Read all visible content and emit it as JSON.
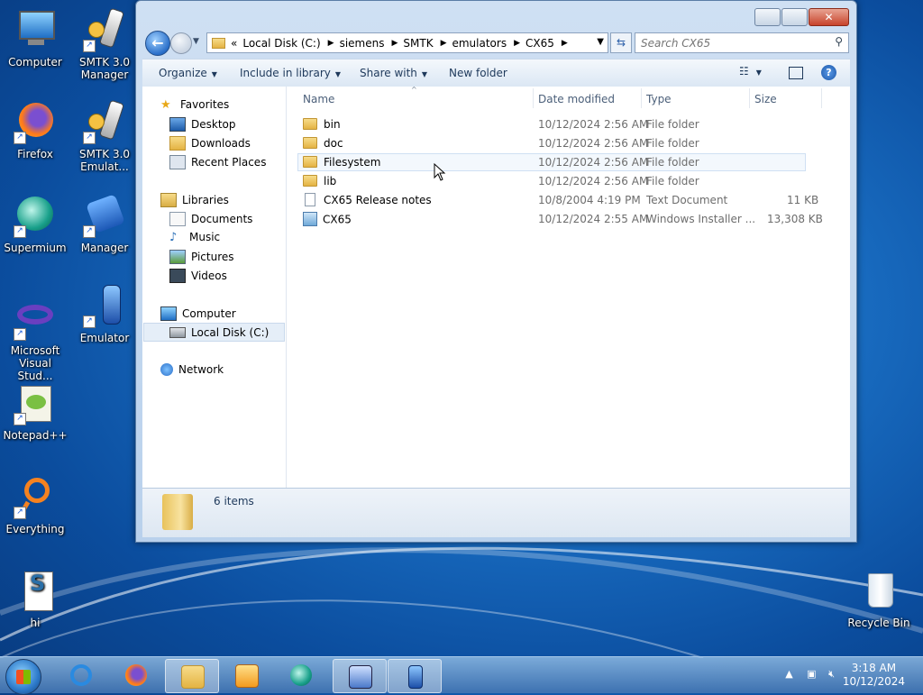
{
  "desktop": {
    "icons": [
      {
        "label": "Computer",
        "icon": "computer-icon"
      },
      {
        "label": "SMTK 3.0 Manager",
        "icon": "phone-shortcut-icon"
      },
      {
        "label": "Firefox",
        "icon": "firefox-icon"
      },
      {
        "label": "SMTK 3.0 Emulat...",
        "icon": "phone-shortcut-icon"
      },
      {
        "label": "Supermium",
        "icon": "supermium-icon"
      },
      {
        "label": "Manager",
        "icon": "phone-manager-icon"
      },
      {
        "label": "Microsoft Visual Stud...",
        "icon": "visual-studio-icon"
      },
      {
        "label": "Emulator",
        "icon": "phone-emulator-icon"
      },
      {
        "label": "Notepad++",
        "icon": "notepad-plus-icon"
      },
      {
        "label": "Everything",
        "icon": "everything-icon"
      },
      {
        "label": "hi",
        "icon": "script-file-icon"
      },
      {
        "label": "Recycle Bin",
        "icon": "recycle-bin-icon"
      }
    ]
  },
  "window": {
    "address": {
      "overflow": "«",
      "segments": [
        "Local Disk (C:)",
        "siemens",
        "SMTK",
        "emulators",
        "CX65"
      ]
    },
    "search": {
      "placeholder": "Search CX65"
    },
    "toolbar": {
      "organize": "Organize",
      "include": "Include in library",
      "share": "Share with",
      "new_folder": "New folder",
      "help": "?"
    },
    "nav": {
      "favorites": "Favorites",
      "desktop": "Desktop",
      "downloads": "Downloads",
      "recent": "Recent Places",
      "libraries": "Libraries",
      "documents": "Documents",
      "music": "Music",
      "pictures": "Pictures",
      "videos": "Videos",
      "computer": "Computer",
      "localdisk": "Local Disk (C:)",
      "network": "Network"
    },
    "columns": {
      "name": "Name",
      "date": "Date modified",
      "type": "Type",
      "size": "Size"
    },
    "files": [
      {
        "name": "bin",
        "date": "10/12/2024 2:56 AM",
        "type": "File folder",
        "size": ""
      },
      {
        "name": "doc",
        "date": "10/12/2024 2:56 AM",
        "type": "File folder",
        "size": ""
      },
      {
        "name": "Filesystem",
        "date": "10/12/2024 2:56 AM",
        "type": "File folder",
        "size": ""
      },
      {
        "name": "lib",
        "date": "10/12/2024 2:56 AM",
        "type": "File folder",
        "size": ""
      },
      {
        "name": "CX65 Release notes",
        "date": "10/8/2004 4:19 PM",
        "type": "Text Document",
        "size": "11 KB"
      },
      {
        "name": "CX65",
        "date": "10/12/2024 2:55 AM",
        "type": "Windows Installer ...",
        "size": "13,308 KB"
      }
    ],
    "details": {
      "items_count": "6 items"
    }
  },
  "taskbar": {
    "time": "3:18 AM",
    "date": "10/12/2024"
  },
  "colors": {
    "accent": "#1a6fc4",
    "selection": "#e5eef8"
  }
}
